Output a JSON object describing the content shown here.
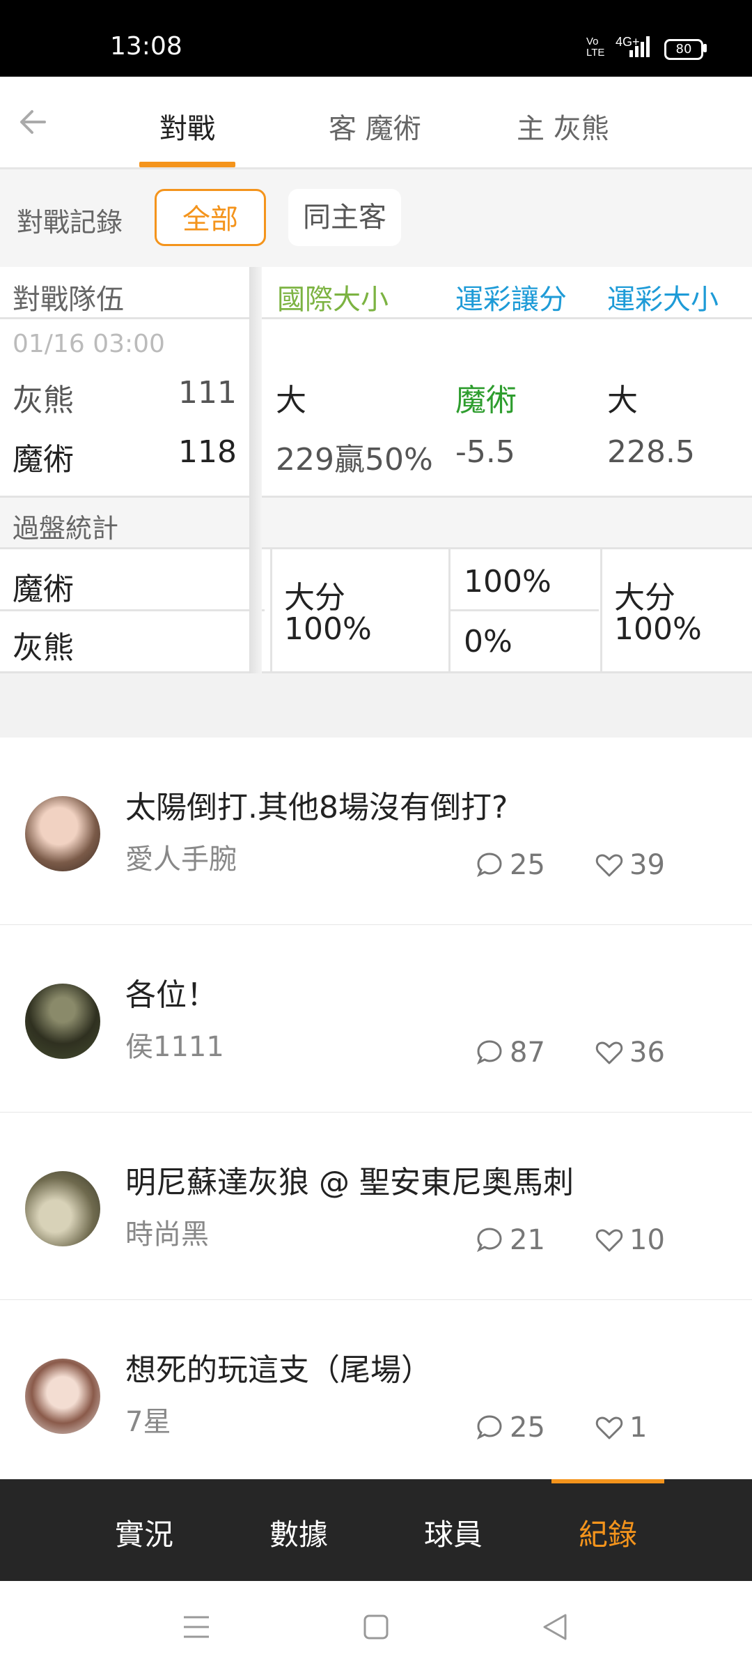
{
  "status": {
    "time": "13:08",
    "network": "4G+",
    "volte": "Vo LTE",
    "battery": "80"
  },
  "header": {
    "tabs": [
      {
        "label": "對戰",
        "active": true
      },
      {
        "label": "客 魔術",
        "active": false
      },
      {
        "label": "主 灰熊",
        "active": false
      }
    ]
  },
  "filter": {
    "label": "對戰記錄",
    "chips": [
      "全部",
      "同主客"
    ]
  },
  "table": {
    "col_team": "對戰隊伍",
    "col_intl": "國際大小",
    "col_spread": "運彩讓分",
    "col_total": "運彩大小",
    "date": "01/16 03:00",
    "rows": [
      {
        "team": "灰熊",
        "score": "111",
        "intl": "大",
        "spread": "魔術",
        "total": "大"
      },
      {
        "team": "魔術",
        "score": "118",
        "intl": "229贏50%",
        "spread": "-5.5",
        "total": "228.5"
      }
    ],
    "stats_label": "過盤統計",
    "stats": {
      "teams": [
        "魔術",
        "灰熊"
      ],
      "intl": [
        "大分",
        "100%"
      ],
      "spread": [
        "100%",
        "0%"
      ],
      "total": [
        "大分",
        "100%"
      ]
    }
  },
  "colors": {
    "accent": "#f4941c",
    "intl_header": "#7cb342",
    "blue_header": "#1e9bd7",
    "spread_green": "#2e9d2e"
  },
  "posts": [
    {
      "title": "太陽倒打.其他8場沒有倒打?",
      "author": "愛人手腕",
      "comments": "25",
      "likes": "39"
    },
    {
      "title": "各位！",
      "author": "侯1111",
      "comments": "87",
      "likes": "36"
    },
    {
      "title": "明尼蘇達灰狼 @ 聖安東尼奧馬刺",
      "author": "時尚黑",
      "comments": "21",
      "likes": "10"
    },
    {
      "title": "想死的玩這支（尾場）",
      "author": "7星",
      "comments": "25",
      "likes": "1"
    }
  ],
  "bottom_tabs": [
    {
      "label": "實況",
      "active": false
    },
    {
      "label": "數據",
      "active": false
    },
    {
      "label": "球員",
      "active": false
    },
    {
      "label": "紀錄",
      "active": true
    }
  ],
  "icons": {
    "back": "arrow-left-icon",
    "comment": "comment-bubble-icon",
    "like": "heart-icon"
  }
}
